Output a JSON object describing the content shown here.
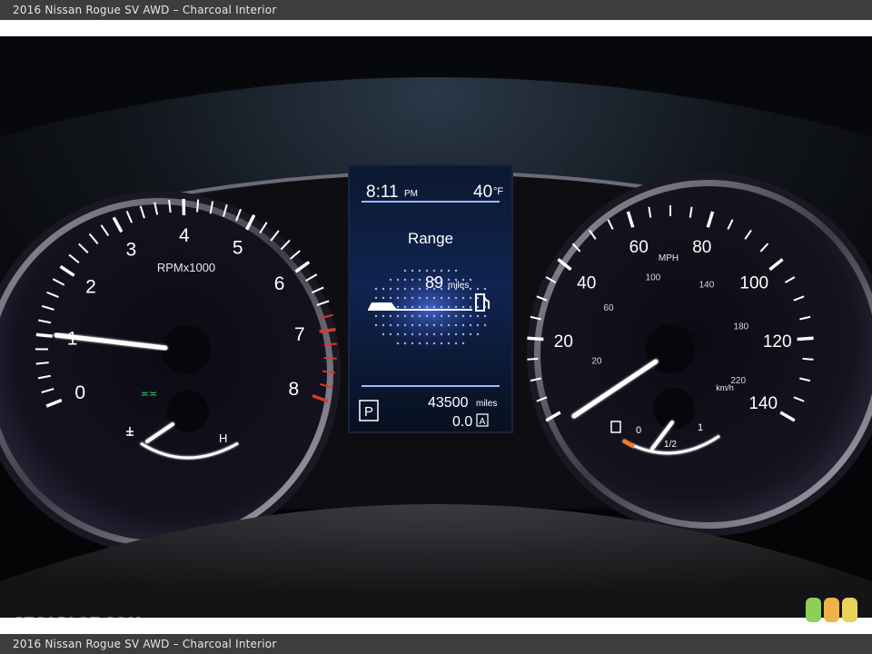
{
  "caption": "2016 Nissan Rogue SV AWD – Charcoal Interior",
  "watermark": "GTCARLOT.COM",
  "tachometer": {
    "unit": "RPMx1000",
    "labels": [
      "0",
      "1",
      "2",
      "3",
      "4",
      "5",
      "6",
      "7",
      "8"
    ],
    "needle_value": 1.0,
    "temp_hot_label": "H"
  },
  "speedometer": {
    "unit_mph": "MPH",
    "unit_kmh": "km/h",
    "mph_labels": [
      "20",
      "40",
      "60",
      "80",
      "100",
      "120",
      "140"
    ],
    "kmh_labels": [
      "20",
      "60",
      "100",
      "140",
      "180",
      "220"
    ],
    "needle_value": 0,
    "fuel_labels": [
      "0",
      "1/2",
      "1"
    ]
  },
  "display": {
    "time": "8:11",
    "time_suffix": "PM",
    "temperature": "40",
    "temperature_unit": "°F",
    "title": "Range",
    "range_value": "89",
    "range_unit": "miles",
    "gear": "P",
    "odometer": "43500",
    "odometer_unit": "miles",
    "trip": "0.0",
    "trip_label": "A"
  },
  "colors": {
    "caption_bar": "#3d3d3d",
    "light_green": "#8ccf5a",
    "light_orange": "#f0b24a",
    "light_yellow": "#e8d35a",
    "gauge_glow": "#ffffff",
    "redline": "#d63a2a",
    "display_blue": "#3e6fd8"
  }
}
